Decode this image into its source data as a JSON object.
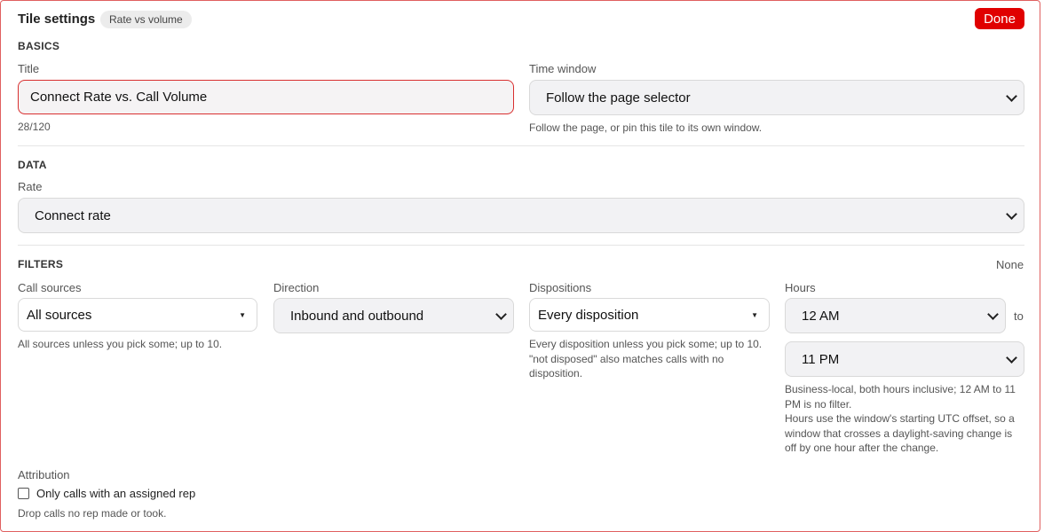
{
  "header": {
    "title": "Tile settings",
    "badge": "Rate vs volume",
    "done_label": "Done"
  },
  "basics": {
    "section": "BASICS",
    "title_label": "Title",
    "title_value": "Connect Rate vs. Call Volume",
    "title_counter": "28/120",
    "time_window_label": "Time window",
    "time_window_value": "Follow the page selector",
    "time_window_hint": "Follow the page, or pin this tile to its own window."
  },
  "data": {
    "section": "DATA",
    "rate_label": "Rate",
    "rate_value": "Connect rate"
  },
  "filters": {
    "section": "FILTERS",
    "summary": "None",
    "call_sources_label": "Call sources",
    "call_sources_value": "All sources",
    "call_sources_hint": "All sources unless you pick some; up to 10.",
    "direction_label": "Direction",
    "direction_value": "Inbound and outbound",
    "dispositions_label": "Dispositions",
    "dispositions_value": "Every disposition",
    "dispositions_hint_1": "Every disposition unless you pick some; up to 10.",
    "dispositions_hint_2": "\"not disposed\" also matches calls with no disposition.",
    "hours_label": "Hours",
    "hours_from": "12 AM",
    "hours_to_word": "to",
    "hours_to": "11 PM",
    "hours_hint_1": "Business-local, both hours inclusive; 12 AM to 11 PM is no filter.",
    "hours_hint_2": "Hours use the window's starting UTC offset, so a window that crosses a daylight-saving change is off by one hour after the change."
  },
  "attribution": {
    "label": "Attribution",
    "checkbox_label": "Only calls with an assigned rep",
    "checked": false,
    "hint": "Drop calls no rep made or took."
  },
  "colors": {
    "accent": "#e00000",
    "error_border": "#d93030",
    "field_bg": "#f2f2f4"
  }
}
